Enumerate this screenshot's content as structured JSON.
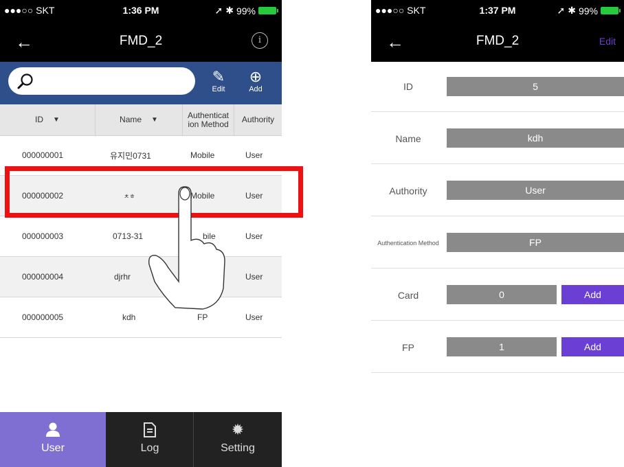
{
  "left": {
    "status": {
      "carrier": "●●●○○ SKT",
      "time": "1:36 PM",
      "battery": "99%"
    },
    "nav": {
      "back": "←",
      "title": "FMD_2",
      "info": "i"
    },
    "toolbar": {
      "edit_label": "Edit",
      "add_label": "Add"
    },
    "columns": [
      "ID",
      "Name",
      "Authenticat ion Method",
      "Authority"
    ],
    "rows": [
      {
        "id": "000000001",
        "name": "유지민0731",
        "method": "Mobile",
        "authority": "User"
      },
      {
        "id": "000000002",
        "name": "ㅊㅎ",
        "method": "Mobile",
        "authority": "User"
      },
      {
        "id": "000000003",
        "name": "0713-31",
        "method": "bile",
        "authority": "User"
      },
      {
        "id": "000000004",
        "name": "djrhr",
        "method": "",
        "authority": "User"
      },
      {
        "id": "000000005",
        "name": "kdh",
        "method": "FP",
        "authority": "User"
      }
    ],
    "tabs": [
      {
        "label": "User"
      },
      {
        "label": "Log"
      },
      {
        "label": "Setting"
      }
    ]
  },
  "right": {
    "status": {
      "carrier": "●●●○○ SKT",
      "time": "1:37 PM",
      "battery": "99%"
    },
    "nav": {
      "back": "←",
      "title": "FMD_2",
      "edit": "Edit"
    },
    "fields": [
      {
        "label": "ID",
        "value": "5"
      },
      {
        "label": "Name",
        "value": "kdh"
      },
      {
        "label": "Authority",
        "value": "User"
      },
      {
        "label": "Authentication Method",
        "value": "FP"
      },
      {
        "label": "Card",
        "value": "0",
        "button": "Add"
      },
      {
        "label": "FP",
        "value": "1",
        "button": "Add"
      }
    ]
  },
  "colors": {
    "accent": "#6b3fd3",
    "header_blue": "#2f4f8b",
    "tab_active": "#7f6fd3",
    "highlight": "#ee1111"
  }
}
